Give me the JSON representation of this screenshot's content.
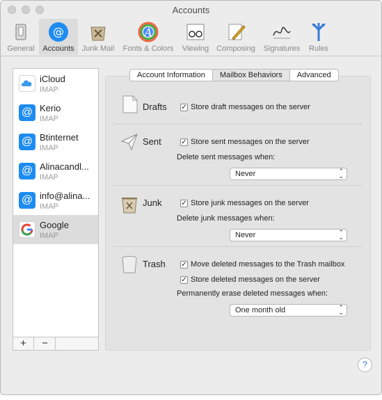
{
  "window": {
    "title": "Accounts"
  },
  "toolbar": {
    "items": [
      {
        "label": "General"
      },
      {
        "label": "Accounts"
      },
      {
        "label": "Junk Mail"
      },
      {
        "label": "Fonts & Colors"
      },
      {
        "label": "Viewing"
      },
      {
        "label": "Composing"
      },
      {
        "label": "Signatures"
      },
      {
        "label": "Rules"
      }
    ]
  },
  "accounts": {
    "items": [
      {
        "name": "iCloud",
        "type": "IMAP",
        "icon": "icloud-icon"
      },
      {
        "name": "Kerio",
        "type": "IMAP",
        "icon": "at-icon"
      },
      {
        "name": "Btinternet",
        "type": "IMAP",
        "icon": "at-icon"
      },
      {
        "name": "Alinacandl...",
        "type": "IMAP",
        "icon": "at-icon"
      },
      {
        "name": "info@alina...",
        "type": "IMAP",
        "icon": "at-icon"
      },
      {
        "name": "Google",
        "type": "IMAP",
        "icon": "google-icon"
      }
    ],
    "add_label": "+",
    "remove_label": "−"
  },
  "tabs": [
    {
      "label": "Account Information"
    },
    {
      "label": "Mailbox Behaviors"
    },
    {
      "label": "Advanced"
    }
  ],
  "sections": {
    "drafts": {
      "title": "Drafts",
      "store": "Store draft messages on the server",
      "checked": true
    },
    "sent": {
      "title": "Sent",
      "store": "Store sent messages on the server",
      "delete_label": "Delete sent messages when:",
      "delete_value": "Never",
      "checked": true
    },
    "junk": {
      "title": "Junk",
      "store": "Store junk messages on the server",
      "delete_label": "Delete junk messages when:",
      "delete_value": "Never",
      "checked": true
    },
    "trash": {
      "title": "Trash",
      "move": "Move deleted messages to the Trash mailbox",
      "store": "Store deleted messages on the server",
      "erase_label": "Permanently erase deleted messages when:",
      "erase_value": "One month old",
      "checked": true
    }
  },
  "help_label": "?",
  "check_glyph": "✓",
  "accent": "#1d8cf0"
}
